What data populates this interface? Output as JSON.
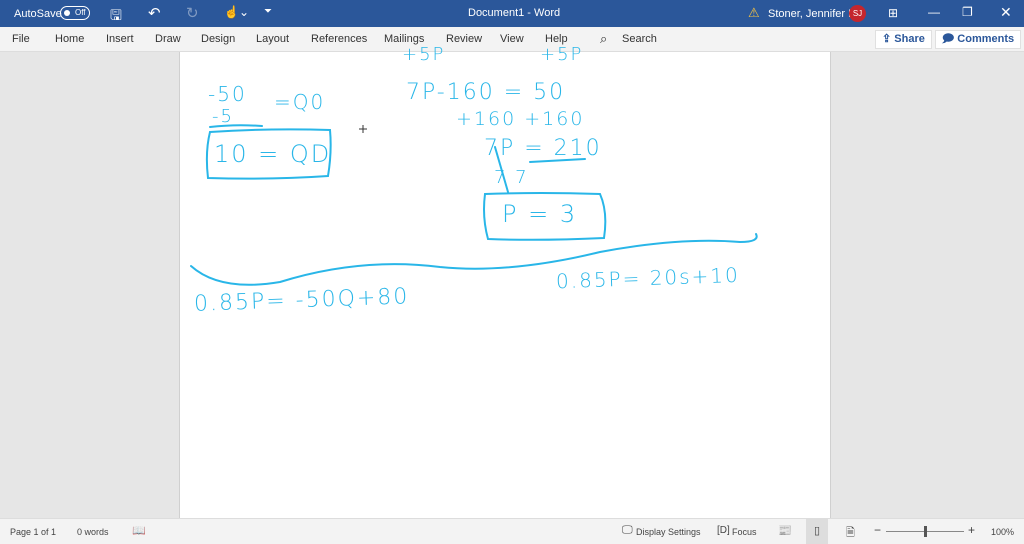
{
  "titlebar": {
    "autosave": "AutoSave",
    "autosave_state": "Off",
    "document_title": "Document1  -  Word",
    "user": "Stoner, Jennifer L",
    "initials": "SJ"
  },
  "ribbon": {
    "tabs": [
      "File",
      "Home",
      "Insert",
      "Draw",
      "Design",
      "Layout",
      "References",
      "Mailings",
      "Review",
      "View",
      "Help"
    ],
    "search": "Search",
    "share": "Share",
    "comments": "Comments"
  },
  "ink": {
    "top_left": "+5P",
    "top_right": "+5P",
    "div_num": "-50",
    "div_den": "-5",
    "div_eq": "=Q0",
    "boxed_q": "10 = QD",
    "eq1": "7P-160 = 50",
    "eq1_add": "+160   +160",
    "eq2": "7P = 210",
    "eq2_div": "7      7",
    "boxed_p": "P = 3",
    "demand": "0.85P= -50Q+80",
    "supply": "0.85P= 20s+10"
  },
  "status": {
    "page": "Page 1 of 1",
    "words": "0 words",
    "display_settings": "Display Settings",
    "focus": "Focus",
    "zoom": "100%",
    "zoom_fraction": 0.5
  }
}
